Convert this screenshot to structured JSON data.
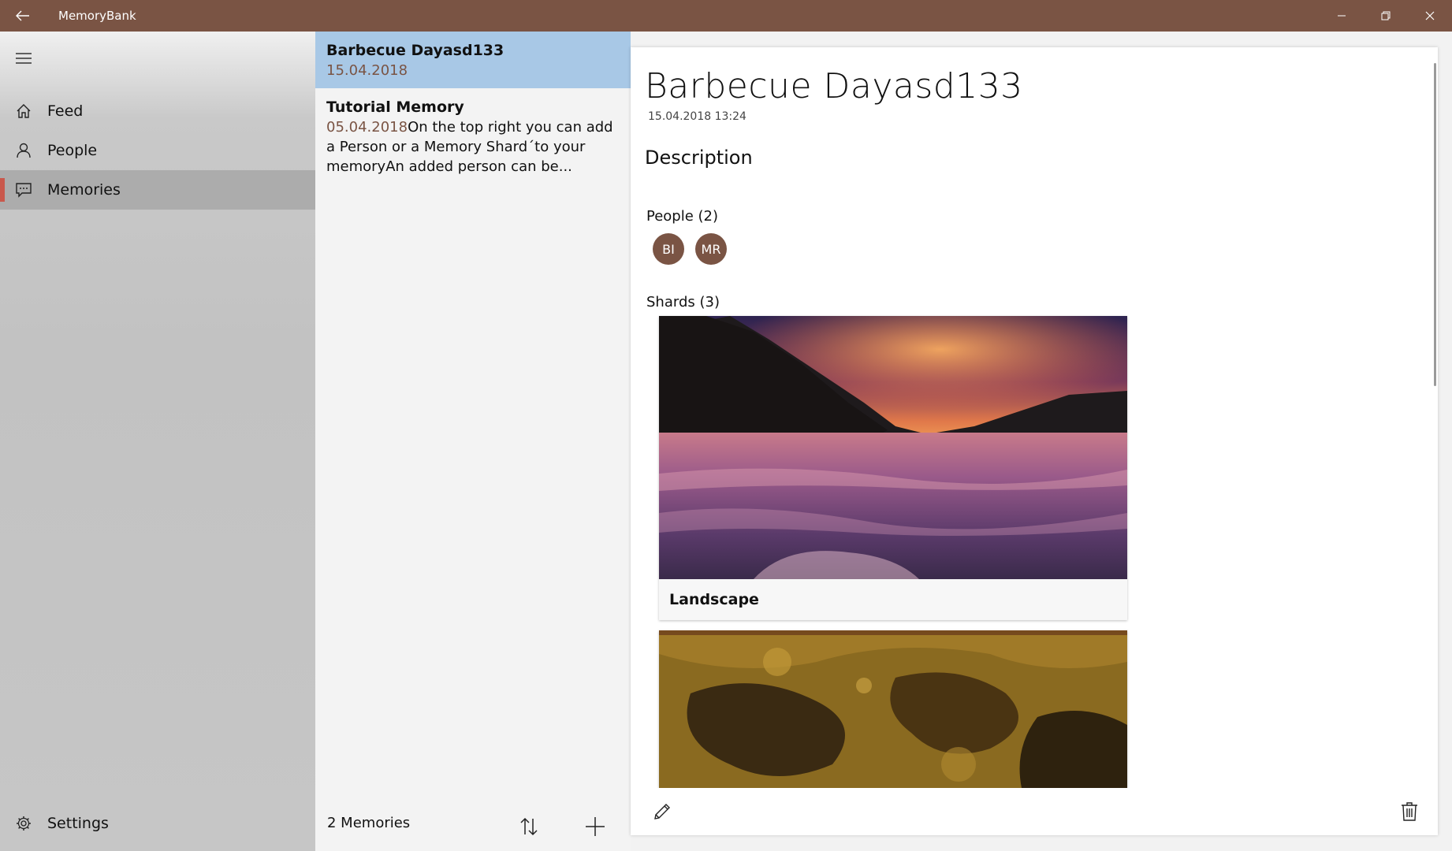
{
  "window": {
    "title": "MemoryBank",
    "accent": "#7a5444"
  },
  "nav": {
    "items": [
      {
        "label": "Feed",
        "icon": "home-icon"
      },
      {
        "label": "People",
        "icon": "person-icon"
      },
      {
        "label": "Memories",
        "icon": "chat-icon",
        "selected": true
      }
    ],
    "settings_label": "Settings"
  },
  "list": {
    "items": [
      {
        "title": "Barbecue Dayasd133",
        "date": "15.04.2018",
        "text": "",
        "selected": true
      },
      {
        "title": "Tutorial Memory",
        "date": "05.04.2018",
        "text": "On the top right you can add a Person or a Memory Shard´to your memoryAn added person can be..."
      }
    ],
    "count_label": "2 Memories"
  },
  "detail": {
    "title": "Barbecue Dayasd133",
    "date": "15.04.2018 13:24",
    "description_heading": "Description",
    "people_heading": "People (2)",
    "people": [
      "BI",
      "MR"
    ],
    "shards_heading": "Shards (3)",
    "shards": [
      {
        "caption": "Landscape",
        "image": "sunset-river-photo"
      },
      {
        "caption": "",
        "image": "rusty-texture-photo"
      }
    ]
  }
}
